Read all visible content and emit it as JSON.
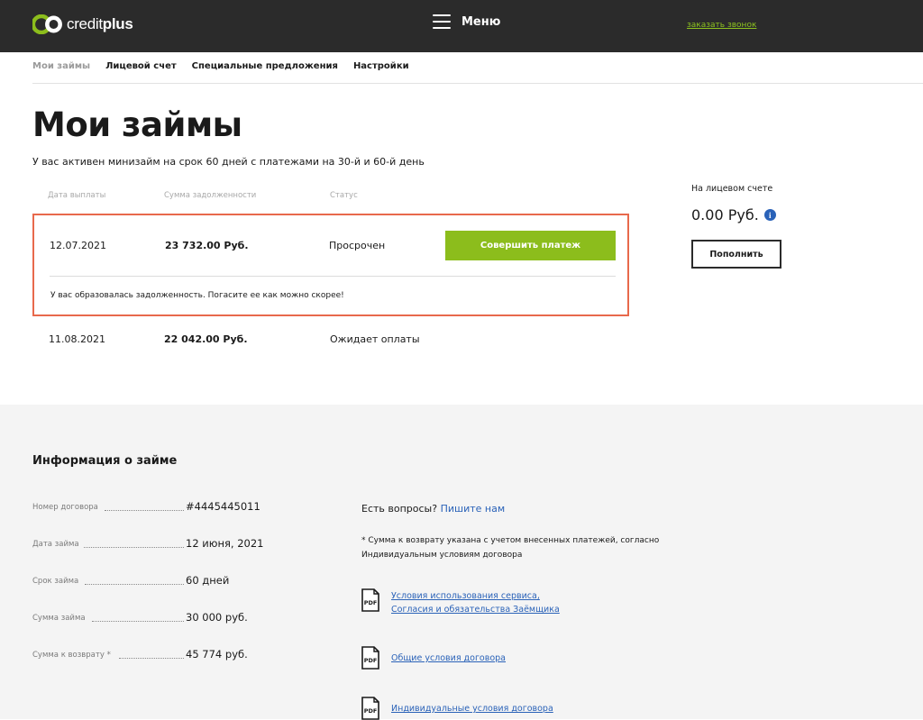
{
  "header": {
    "logo_text_light": "credit",
    "logo_text_bold": "plus",
    "menu_label": "Меню",
    "callback_link": "заказать звонок",
    "brand_color": "#8cbd1c"
  },
  "subnav": [
    {
      "label": "Мои займы",
      "active": true
    },
    {
      "label": "Лицевой счет"
    },
    {
      "label": "Специальные предложения"
    },
    {
      "label": "Настройки"
    }
  ],
  "main": {
    "title": "Мои займы",
    "subtitle": "У вас активен минизайм на срок 60 дней с платежами на 30-й и 60-й день",
    "columns": [
      "Дата выплаты",
      "Сумма задолженности",
      "Статус"
    ],
    "payments": [
      {
        "date": "12.07.2021",
        "amount": "23 732.00 Руб.",
        "status": "Просрочен",
        "action": "Совершить платеж",
        "warning": "У вас образовалась задолженность. Погасите ее как можно скорее!"
      },
      {
        "date": "11.08.2021",
        "amount": "22 042.00 Руб.",
        "status": "Ожидает оплаты"
      }
    ]
  },
  "account": {
    "label": "На лицевом счете",
    "balance": "0.00 Руб.",
    "info_glyph": "i",
    "topup_label": "Пополнить"
  },
  "loan_info": {
    "title": "Информация о займе",
    "rows": [
      {
        "label": "Номер договора",
        "value": "#4445445011"
      },
      {
        "label": "Дата займа",
        "value": "12 июня, 2021"
      },
      {
        "label": "Срок займа",
        "value": "60 дней"
      },
      {
        "label": "Сумма займа",
        "value": "30 000 руб."
      },
      {
        "label": "Сумма к возврату *",
        "value": "45 774 руб."
      }
    ],
    "questions_text": "Есть вопросы?",
    "questions_link": "Пишите нам",
    "note": "* Сумма к возврату указана с учетом внесенных платежей, согласно Индивидуальным условиям договора",
    "pdf_label": "PDF",
    "documents": [
      {
        "links": [
          "Условия использования сервиса,",
          "Согласия и обязательства Заёмщика"
        ]
      },
      {
        "links": [
          "Общие условия договора"
        ]
      },
      {
        "links": [
          "Индивидуальные условия договора"
        ]
      }
    ]
  }
}
